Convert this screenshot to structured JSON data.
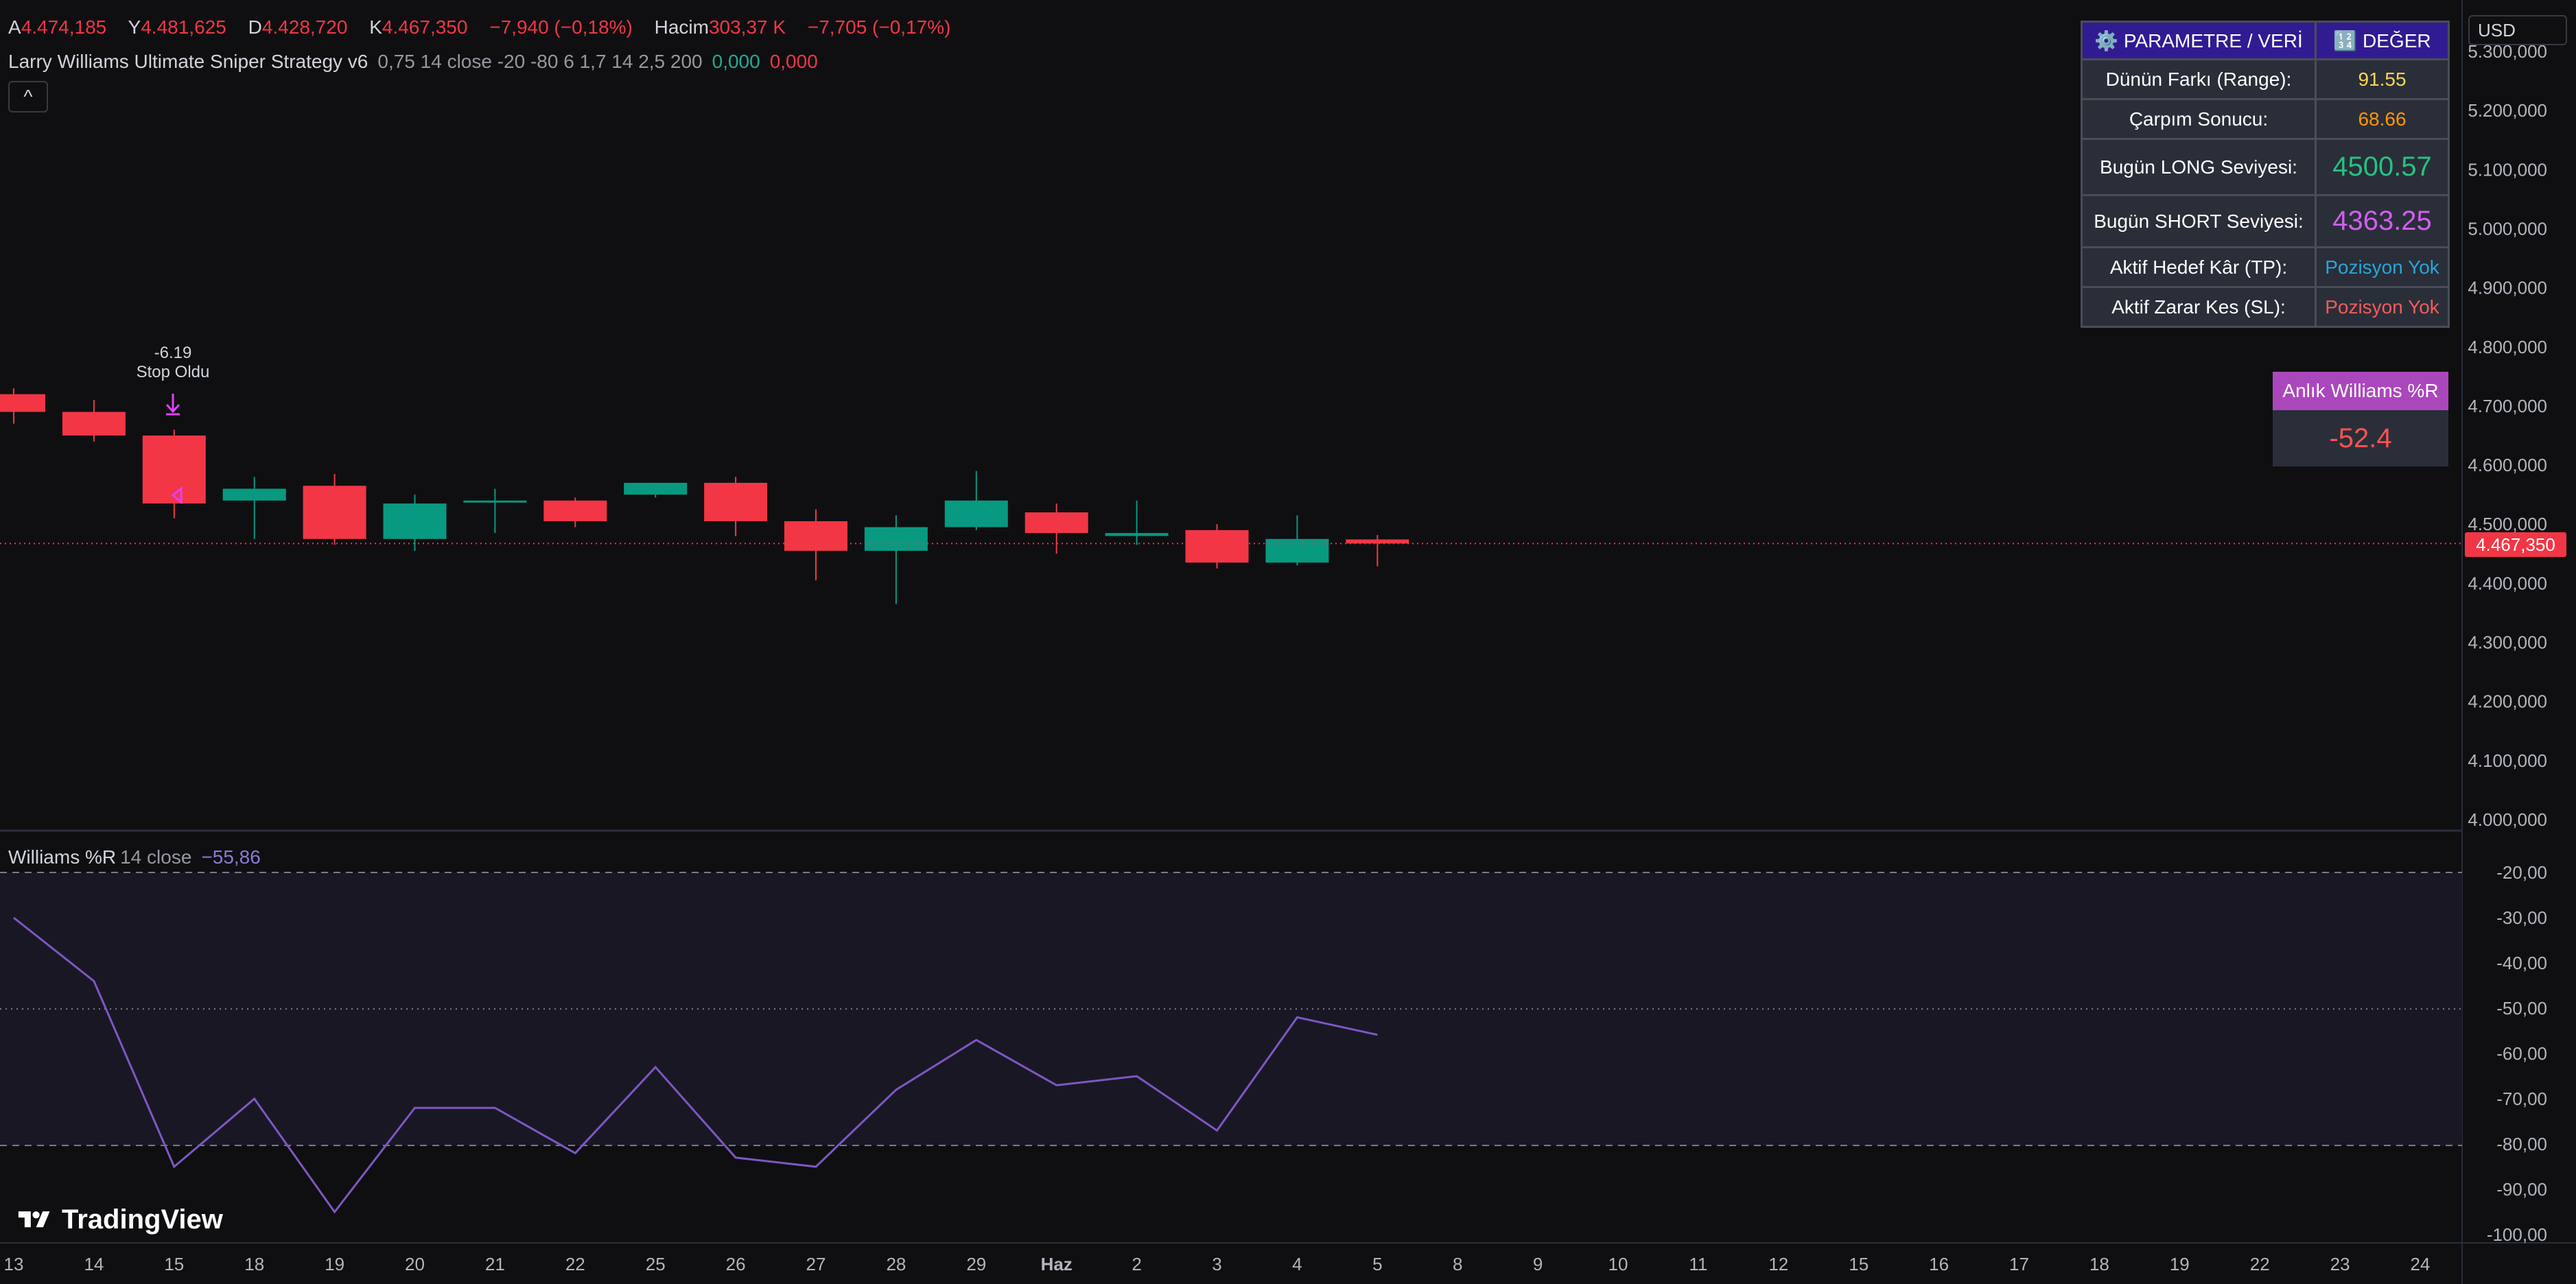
{
  "ohlc": {
    "open_label": "A",
    "open": "4.474,185",
    "high_label": "Y",
    "high": "4.481,625",
    "low_label": "D",
    "low": "4.428,720",
    "close_label": "K",
    "close": "4.467,350",
    "change": "−7,940 (−0,18%)",
    "volume_label": "Hacim",
    "volume": "303,37 K",
    "volume_change": "−7,705 (−0,17%)"
  },
  "strategy": {
    "name": "Larry Williams Ultimate Sniper Strategy v6",
    "params": "0,75 14 close -20 -80 6 1,7 14 2,5 200",
    "val1": "0,000",
    "val2": "0,000"
  },
  "indicator": {
    "name": "Williams %R",
    "params": "14 close",
    "value": "−55,86"
  },
  "currency": "USD",
  "collapse_glyph": "^",
  "last_price_tag": "4.467,350",
  "signal": {
    "value": "-6.19",
    "label": "Stop Oldu"
  },
  "param_table": {
    "header": [
      "⚙️ PARAMETRE / VERİ",
      "🔢 DEĞER"
    ],
    "rows": [
      {
        "label": "Dünün Farkı (Range):",
        "value": "91.55"
      },
      {
        "label": "Çarpım Sonucu:",
        "value": "68.66"
      },
      {
        "label": "Bugün LONG Seviyesi:",
        "value": "4500.57"
      },
      {
        "label": "Bugün SHORT Seviyesi:",
        "value": "4363.25"
      },
      {
        "label": "Aktif Hedef Kâr (TP):",
        "value": "Pozisyon Yok"
      },
      {
        "label": "Aktif Zarar Kes (SL):",
        "value": "Pozisyon Yok"
      }
    ]
  },
  "williams_box": {
    "title": "Anlık Williams %R",
    "value": "-52.4"
  },
  "branding": "TradingView",
  "price_axis": [
    "5.300,000",
    "5.200,000",
    "5.100,000",
    "5.000,000",
    "4.900,000",
    "4.800,000",
    "4.700,000",
    "4.600,000",
    "4.500,000",
    "4.400,000",
    "4.300,000",
    "4.200,000",
    "4.100,000",
    "4.000,000"
  ],
  "wr_axis": [
    "-20,00",
    "-30,00",
    "-40,00",
    "-50,00",
    "-60,00",
    "-70,00",
    "-80,00",
    "-90,00",
    "-100,00"
  ],
  "x_axis": [
    "13",
    "14",
    "15",
    "18",
    "19",
    "20",
    "21",
    "22",
    "25",
    "26",
    "27",
    "28",
    "29",
    "Haz",
    "2",
    "3",
    "4",
    "5",
    "8",
    "9",
    "10",
    "11",
    "12",
    "15",
    "16",
    "17",
    "18",
    "19",
    "22",
    "23",
    "24"
  ],
  "colors": {
    "bull": "#089981",
    "bear": "#f23645",
    "wr_line": "#7e57c2",
    "background": "#0f0f11"
  },
  "chart_data": [
    {
      "type": "candlestick",
      "y_range": [
        4000000,
        5300000
      ],
      "last_price": 4467350,
      "candles": [
        {
          "x": "13",
          "open": 4720000,
          "high": 4730000,
          "low": 4670000,
          "close": 4690000
        },
        {
          "x": "14",
          "open": 4690000,
          "high": 4710000,
          "low": 4640000,
          "close": 4650000
        },
        {
          "x": "15",
          "open": 4650000,
          "high": 4660000,
          "low": 4510000,
          "close": 4535000
        },
        {
          "x": "18",
          "open": 4540000,
          "high": 4580000,
          "low": 4475000,
          "close": 4560000
        },
        {
          "x": "19",
          "open": 4565000,
          "high": 4585000,
          "low": 4465000,
          "close": 4475000
        },
        {
          "x": "20",
          "open": 4475000,
          "high": 4550000,
          "low": 4455000,
          "close": 4535000
        },
        {
          "x": "21",
          "open": 4540000,
          "high": 4560000,
          "low": 4485000,
          "close": 4540000
        },
        {
          "x": "22",
          "open": 4540000,
          "high": 4545000,
          "low": 4495000,
          "close": 4505000
        },
        {
          "x": "25",
          "open": 4550000,
          "high": 4570000,
          "low": 4545000,
          "close": 4570000
        },
        {
          "x": "26",
          "open": 4570000,
          "high": 4580000,
          "low": 4480000,
          "close": 4505000
        },
        {
          "x": "27",
          "open": 4505000,
          "high": 4525000,
          "low": 4405000,
          "close": 4455000
        },
        {
          "x": "28",
          "open": 4455000,
          "high": 4515000,
          "low": 4365000,
          "close": 4495000
        },
        {
          "x": "29",
          "open": 4495000,
          "high": 4590000,
          "low": 4490000,
          "close": 4540000
        },
        {
          "x": "Haz",
          "open": 4520000,
          "high": 4535000,
          "low": 4450000,
          "close": 4485000
        },
        {
          "x": "2",
          "open": 4480000,
          "high": 4540000,
          "low": 4465000,
          "close": 4485000
        },
        {
          "x": "3",
          "open": 4490000,
          "high": 4500000,
          "low": 4425000,
          "close": 4435000
        },
        {
          "x": "4",
          "open": 4435000,
          "high": 4515000,
          "low": 4430000,
          "close": 4475000
        },
        {
          "x": "5",
          "open": 4474185,
          "high": 4481625,
          "low": 4428720,
          "close": 4467350
        }
      ]
    },
    {
      "type": "line",
      "name": "Williams %R",
      "y_range": [
        -100,
        -20
      ],
      "upper_band": -20,
      "middle_band": -50,
      "lower_band": -80,
      "x": [
        "13",
        "14",
        "15",
        "18",
        "19",
        "20",
        "21",
        "22",
        "25",
        "26",
        "27",
        "28",
        "29",
        "Haz",
        "2",
        "3",
        "4",
        "5"
      ],
      "values": [
        -30,
        -44,
        -85,
        -70,
        -95,
        -72,
        -72,
        -82,
        -63,
        -83,
        -85,
        -68,
        -57,
        -67,
        -65,
        -77,
        -52,
        -55.86
      ]
    }
  ]
}
